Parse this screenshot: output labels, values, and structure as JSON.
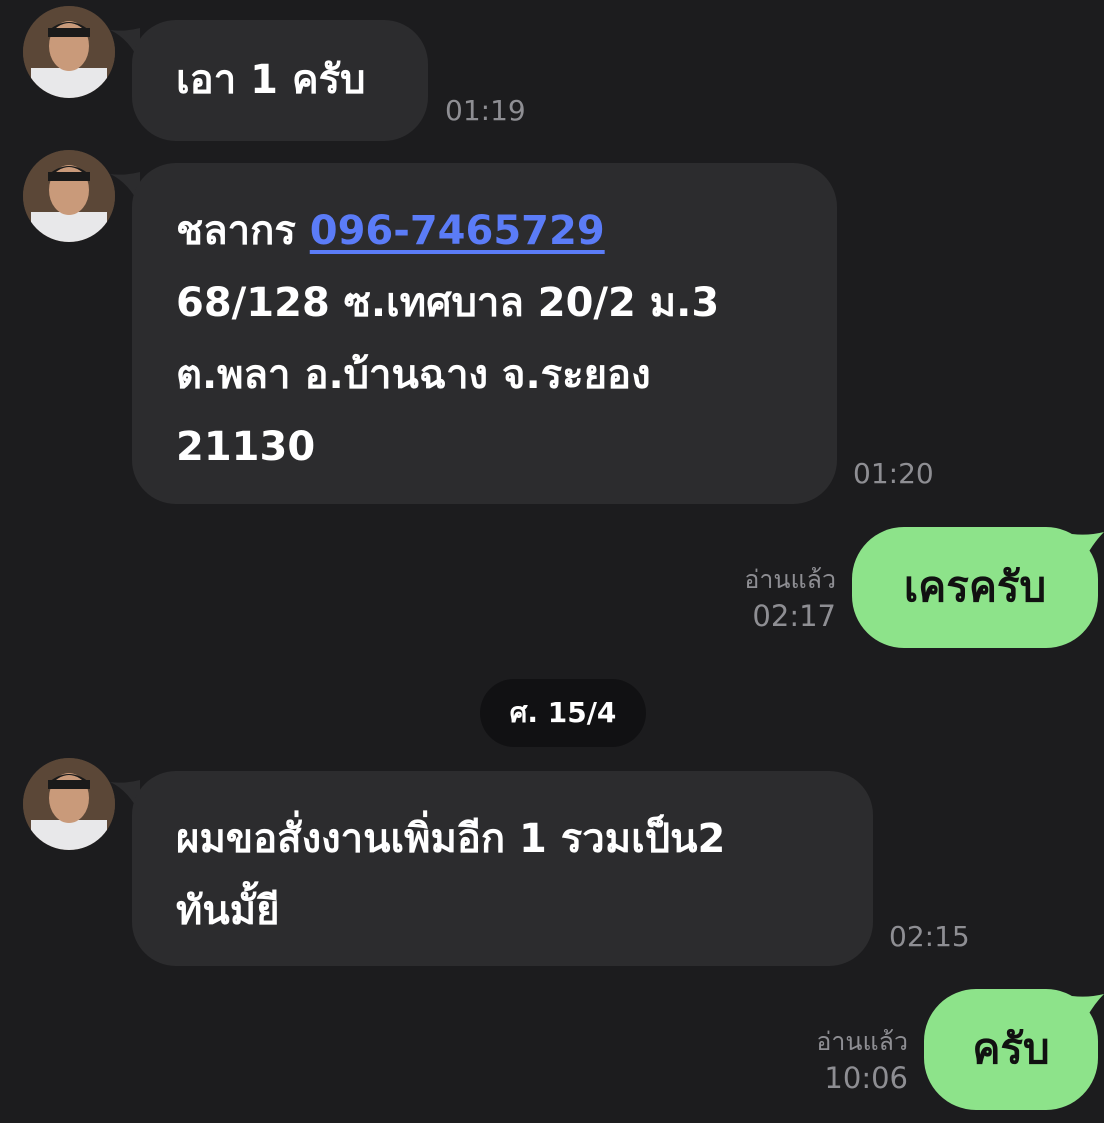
{
  "contact": {
    "avatar_icon": "contact-avatar-photo"
  },
  "messages": [
    {
      "direction": "incoming",
      "lines": [
        "เอา 1 ครับ"
      ],
      "time": "01:19"
    },
    {
      "direction": "incoming",
      "name_prefix": "ชลากร ",
      "phone": "096-7465729",
      "lines": [
        "68/128 ซ.เทศบาล 20/2 ม.3",
        "ต.พลา อ.บ้านฉาง จ.ระยอง",
        "21130"
      ],
      "time": "01:20"
    },
    {
      "direction": "outgoing",
      "text": "เครครับ",
      "read_label": "อ่านแล้ว",
      "time": "02:17"
    },
    {
      "direction": "incoming",
      "lines": [
        "ผมขอสั่งงานเพิ่มอีก 1 รวมเป็น2",
        "ทันมั้ยี"
      ],
      "time": "02:15"
    },
    {
      "direction": "outgoing",
      "text": "ครับ",
      "read_label": "อ่านแล้ว",
      "time": "10:06"
    }
  ],
  "date_separator": "ศ. 15/4",
  "colors": {
    "background": "#1c1c1e",
    "incoming_bubble": "#2c2c2e",
    "outgoing_bubble": "#8de38a",
    "link": "#5b7cf7",
    "timestamp": "#8e8e93"
  }
}
